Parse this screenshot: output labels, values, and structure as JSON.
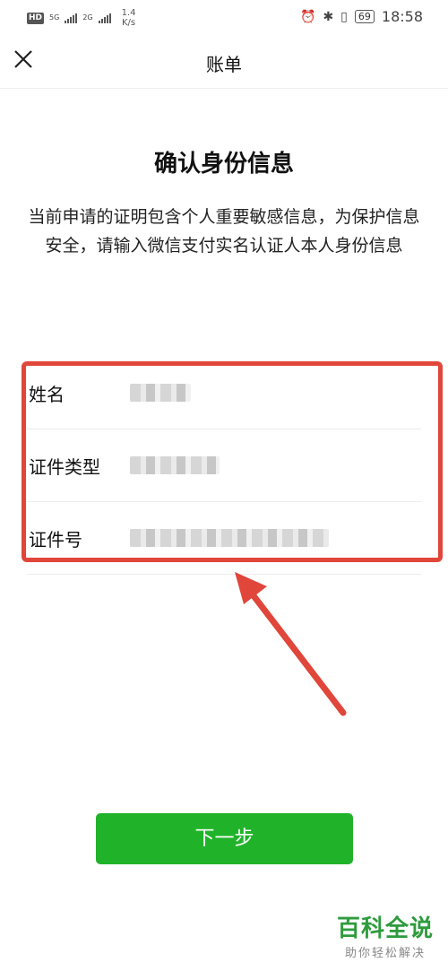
{
  "status_bar": {
    "hd": "HD",
    "sim1_net": "5G",
    "sim2_net": "2G",
    "speed_value": "1.4",
    "speed_unit": "K/s",
    "battery": "69",
    "time": "18:58"
  },
  "nav": {
    "title": "账单"
  },
  "heading": "确认身份信息",
  "description": "当前申请的证明包含个人重要敏感信息，为保护信息安全，请输入微信支付实名认证人本人身份信息",
  "form": {
    "rows": [
      {
        "label": "姓名"
      },
      {
        "label": "证件类型"
      },
      {
        "label": "证件号"
      }
    ]
  },
  "next_label": "下一步",
  "watermark": {
    "title": "百科全说",
    "subtitle": "助你轻松解决"
  },
  "colors": {
    "primary_green": "#20b32a",
    "annotation_red": "#e0463a"
  }
}
